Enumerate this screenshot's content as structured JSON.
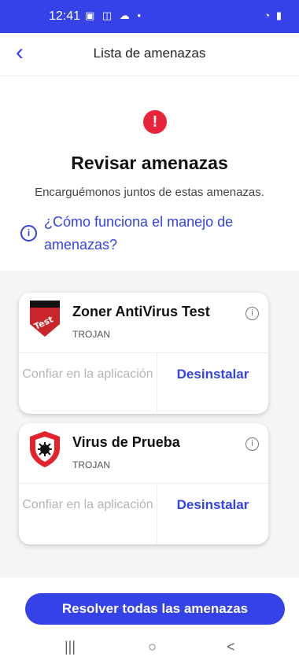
{
  "status": {
    "time": "12:41",
    "left_icons": "▣ ◫ ☁ •",
    "right_icons": "◔ ▮"
  },
  "header": {
    "title": "Lista de amenazas",
    "back_icon": "‹"
  },
  "main": {
    "title": "Revisar amenazas",
    "subtitle": "Encarguémonos juntos de estas amenazas.",
    "info_link": "¿Cómo funciona el manejo de amenazas?",
    "alert_icon": "!"
  },
  "threats": [
    {
      "name": "Zoner AntiVirus Test",
      "type": "TROJAN",
      "trust": "Confiar en la aplicación",
      "uninstall": "Desinstalar"
    },
    {
      "name": "Virus de Prueba",
      "type": "TROJAN",
      "trust": "Confiar en la aplicación",
      "uninstall": "Desinstalar"
    }
  ],
  "footer": {
    "resolve": "Resolver todas las amenazas"
  },
  "nav": {
    "recent": "|||",
    "home": "○",
    "back": "<"
  },
  "colors": {
    "accent": "#3442e8",
    "danger": "#e8233a"
  }
}
